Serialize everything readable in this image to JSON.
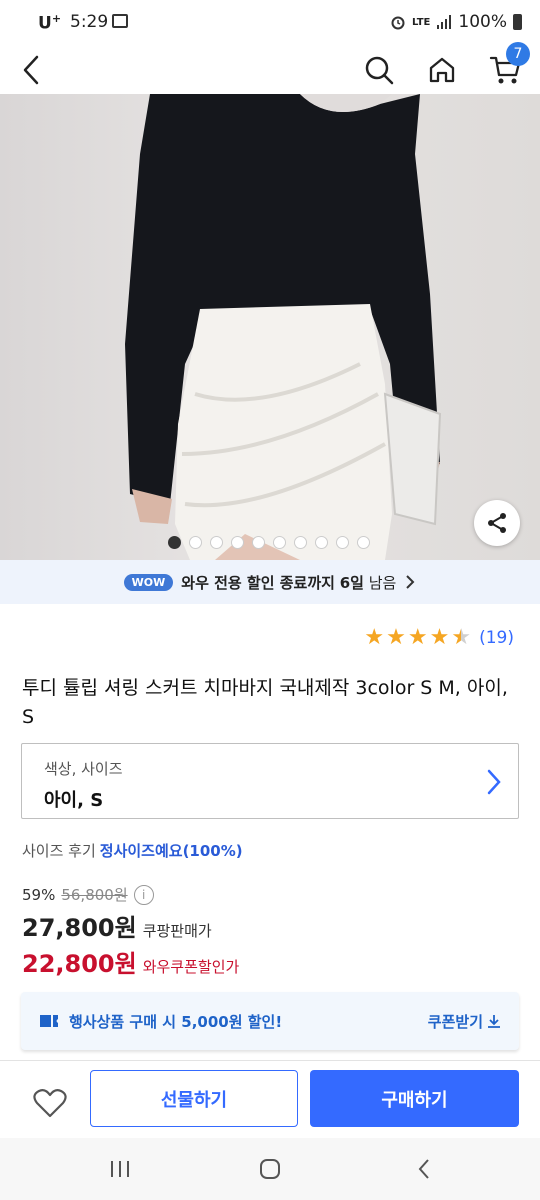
{
  "status_bar": {
    "carrier": "U",
    "carrier_sup": "+",
    "time": "5:29",
    "network": "LTE",
    "battery": "100%"
  },
  "header": {
    "cart_count": "7"
  },
  "gallery": {
    "image_count": 10,
    "active_index": 0
  },
  "wow_banner": {
    "badge": "WOW",
    "text_prefix": "와우 전용 할인 종료까지",
    "days": "6일",
    "text_suffix": "남음"
  },
  "rating": {
    "stars": 4.5,
    "review_count": "(19)"
  },
  "product": {
    "title": "투디 튤립 셔링 스커트 치마바지 국내제작 3color S M, 아이, S"
  },
  "option": {
    "label": "색상, 사이즈",
    "value": "아이, S"
  },
  "size_review": {
    "label": "사이즈 후기",
    "value": "정사이즈예요(100%)"
  },
  "pricing": {
    "discount": "59%",
    "original_price": "56,800원",
    "coupang_price": "27,800원",
    "coupang_label": "쿠팡판매가",
    "wow_price": "22,800원",
    "wow_label": "와우쿠폰할인가"
  },
  "coupon": {
    "text": "행사상품 구매 시 5,000원 할인!",
    "button": "쿠폰받기"
  },
  "actions": {
    "gift": "선물하기",
    "buy": "구매하기"
  },
  "colors": {
    "accent": "#346aff",
    "wow_red": "#c8102e",
    "star": "#f5a623"
  }
}
